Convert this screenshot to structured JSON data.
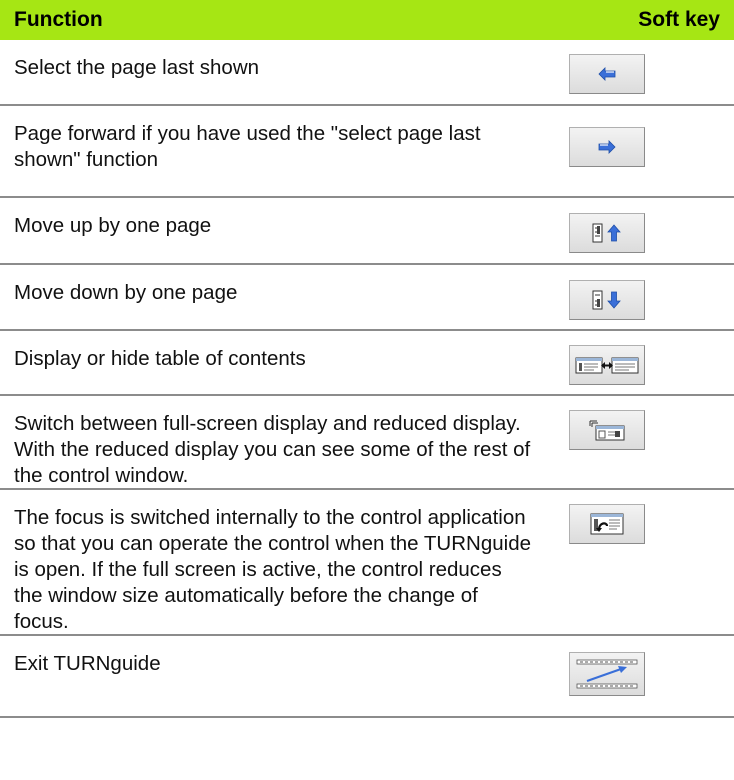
{
  "header": {
    "function_label": "Function",
    "softkey_label": "Soft key"
  },
  "rows": [
    {
      "text": "Select the page last shown",
      "icon": "arrow-left-icon"
    },
    {
      "text": "Page forward if you have used the \"select page last shown\" function",
      "icon": "arrow-right-icon"
    },
    {
      "text": "Move up by one page",
      "icon": "page-up-icon"
    },
    {
      "text": "Move down by one page",
      "icon": "page-down-icon"
    },
    {
      "text": "Display or hide table of contents",
      "icon": "toggle-contents-icon"
    },
    {
      "text": "Switch between full-screen display and reduced display. With the reduced display you can see some of the rest of the control window.",
      "icon": "screen-size-icon"
    },
    {
      "text": "The focus is switched internally to the control application so that you can operate the control when the TURNguide is open. If the full screen is active, the control reduces the window size automatically before the change of focus.",
      "icon": "switch-focus-icon"
    },
    {
      "text": "Exit TURNguide",
      "icon": "exit-icon"
    }
  ],
  "colors": {
    "header_bg": "#a6e614",
    "arrow_blue": "#3a6fd8",
    "divider": "#8c8c8c"
  }
}
